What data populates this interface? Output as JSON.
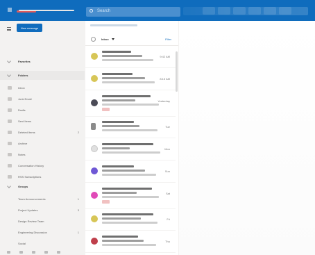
{
  "topbar": {
    "search_placeholder": "Search"
  },
  "leftpane": {
    "new_message_label": "New message",
    "folders": [
      {
        "label": "Favorites",
        "type": "heading"
      },
      {
        "label": "Folders",
        "type": "heading",
        "selected": true
      },
      {
        "label": "Inbox",
        "type": "item"
      },
      {
        "label": "Junk Email",
        "type": "item"
      },
      {
        "label": "Drafts",
        "type": "item"
      },
      {
        "label": "Sent Items",
        "type": "item"
      },
      {
        "label": "Deleted Items",
        "type": "item",
        "count": "2"
      },
      {
        "label": "Archive",
        "type": "item"
      },
      {
        "label": "Notes",
        "type": "item"
      },
      {
        "label": "Conversation History",
        "type": "item"
      },
      {
        "label": "RSS Subscriptions",
        "type": "item"
      },
      {
        "label": "Groups",
        "type": "heading"
      },
      {
        "label": "Team Announcements",
        "type": "item",
        "count": "1"
      },
      {
        "label": "Project Updates",
        "type": "item",
        "count": "3"
      },
      {
        "label": "Design Review Team",
        "type": "item"
      },
      {
        "label": "Engineering Discussion",
        "type": "item",
        "count": "1"
      },
      {
        "label": "Social",
        "type": "item"
      }
    ]
  },
  "listpane": {
    "title": "Inbox",
    "filter_label": "Filter",
    "messages": [
      {
        "avatar_color": "#d7c657",
        "time": "9:42 AM"
      },
      {
        "avatar_color": "#d7c657",
        "time": "8:15 AM"
      },
      {
        "avatar_color": "#4b4b57",
        "time": "Yesterday",
        "attachment": true
      },
      {
        "avatar_color": "#8b8b8b",
        "time": "Tue"
      },
      {
        "avatar_color": "#e0e0e0",
        "time": "Mon"
      },
      {
        "avatar_color": "#6f58d5",
        "time": "Sun"
      },
      {
        "avatar_color": "#e04ab7",
        "time": "Sat",
        "attachment": true
      },
      {
        "avatar_color": "#d7c657",
        "time": "Fri"
      },
      {
        "avatar_color": "#bf3f4b",
        "time": "Thu"
      }
    ]
  }
}
